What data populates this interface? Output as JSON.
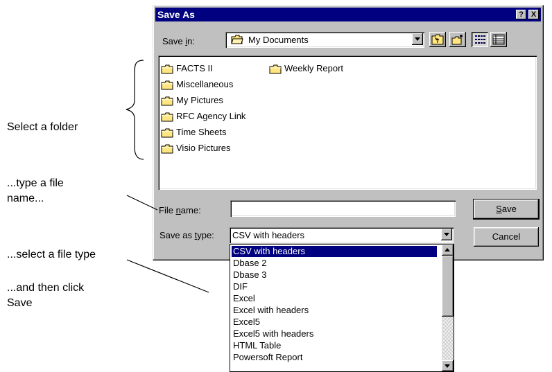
{
  "dialog": {
    "title": "Save As",
    "help_button": "?",
    "close_button": "X"
  },
  "save_in": {
    "label_pre": "Save ",
    "label_u": "i",
    "label_post": "n:",
    "value": "My Documents"
  },
  "folders": [
    {
      "name": "FACTS II"
    },
    {
      "name": "Miscellaneous"
    },
    {
      "name": "My Pictures"
    },
    {
      "name": "RFC Agency Link"
    },
    {
      "name": "Time Sheets"
    },
    {
      "name": "Visio Pictures"
    },
    {
      "name": "Weekly Report"
    }
  ],
  "file_name": {
    "label_pre": "File ",
    "label_u": "n",
    "label_post": "ame:",
    "value": ""
  },
  "save_as_type": {
    "label_pre": "Save as ",
    "label_u": "t",
    "label_post": "ype:",
    "value": "CSV with headers"
  },
  "buttons": {
    "save_u": "S",
    "save_rest": "ave",
    "cancel": "Cancel"
  },
  "type_options": [
    "CSV with headers",
    "Dbase 2",
    "Dbase 3",
    "DIF",
    "Excel",
    "Excel with headers",
    "Excel5",
    "Excel5 with headers",
    "HTML Table",
    "Powersoft Report"
  ],
  "annotations": {
    "select_folder": "Select a folder",
    "type_name_1": "...type a file",
    "type_name_2": "name...",
    "select_type": "...select a file type",
    "click_save_1": "...and then click",
    "click_save_2": "Save"
  },
  "colors": {
    "titlebar": "#000080",
    "face": "#c0c0c0",
    "folder": "#ffe680"
  },
  "icons": [
    "folder-icon",
    "up-folder-icon",
    "new-folder-icon",
    "list-view-icon",
    "details-view-icon",
    "dropdown-arrow-icon"
  ]
}
